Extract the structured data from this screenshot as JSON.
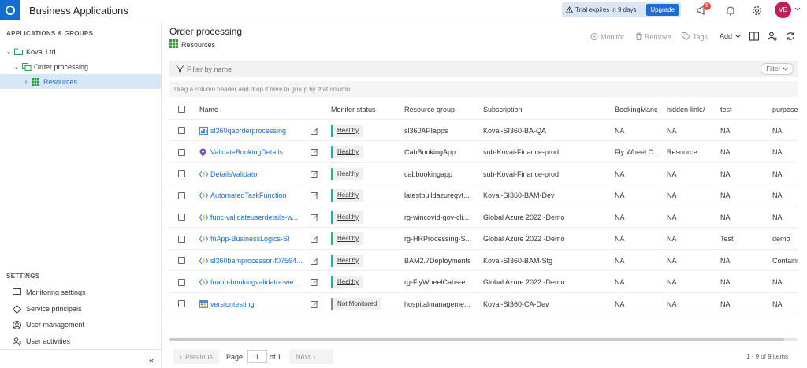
{
  "header": {
    "title": "Business Applications",
    "trial_text": "Trial expires in 9 days",
    "upgrade_label": "Upgrade",
    "notification_count": "5",
    "avatar_initials": "VE"
  },
  "sidebar": {
    "section_title": "APPLICATIONS & GROUPS",
    "tree": {
      "root": "Kovai Ltd",
      "group": "Order processing",
      "selected": "Resources"
    },
    "settings_title": "SETTINGS",
    "settings_items": [
      {
        "label": "Monitoring settings",
        "icon": "monitor-icon"
      },
      {
        "label": "Service principals",
        "icon": "key-icon"
      },
      {
        "label": "User management",
        "icon": "user-icon"
      },
      {
        "label": "User activities",
        "icon": "user-activity-icon"
      }
    ]
  },
  "main": {
    "title": "Order processing",
    "breadcrumb": "Resources",
    "toolbar": {
      "monitor": "Monitor",
      "remove": "Remove",
      "tags": "Tags",
      "add": "Add"
    },
    "filter_placeholder": "Filter by name",
    "filter_button": "Filter",
    "group_hint": "Drag a column header and drop it here to group by that column",
    "columns": [
      "Name",
      "Monitor status",
      "Resource group",
      "Subscription",
      "BookingManc",
      "hidden-link:/",
      "test",
      "purpose"
    ],
    "rows": [
      {
        "name": "sl360qaorderprocessing",
        "icon": "app-service-plan-icon",
        "status": "Healthy",
        "rg": "sl360APIapps",
        "sub": "Kovai-SI360-BA-QA",
        "booking": "NA",
        "hidden": "NA",
        "test": "NA",
        "purpose": "NA"
      },
      {
        "name": "ValidateBookingDetails",
        "icon": "logic-app-icon",
        "status": "Healthy",
        "rg": "CabBookingApp",
        "sub": "sub-Kovai-Finance-prod",
        "booking": "Fly Wheel C...",
        "hidden": "Resource",
        "test": "NA",
        "purpose": "NA"
      },
      {
        "name": "DetailsValidator",
        "icon": "function-app-icon",
        "status": "Healthy",
        "rg": "cabbookingapp",
        "sub": "sub-Kovai-Finance-prod",
        "booking": "NA",
        "hidden": "NA",
        "test": "NA",
        "purpose": "NA"
      },
      {
        "name": "AutomatedTaskFunction",
        "icon": "function-app-icon",
        "status": "Healthy",
        "rg": "latestbuildazuregvt...",
        "sub": "Kovai-SI360-BAM-Dev",
        "booking": "NA",
        "hidden": "NA",
        "test": "NA",
        "purpose": "NA"
      },
      {
        "name": "func-validateuserdetails-w...",
        "icon": "function-app-icon",
        "status": "Healthy",
        "rg": "rg-wincovid-gov-cli...",
        "sub": "Global Azure 2022 -Demo",
        "booking": "NA",
        "hidden": "NA",
        "test": "NA",
        "purpose": "NA"
      },
      {
        "name": "fnApp-BusinessLogics-SI",
        "icon": "function-app-icon",
        "status": "Healthy",
        "rg": "rg-HRProcessing-S...",
        "sub": "Global Azure 2022 -Demo",
        "booking": "NA",
        "hidden": "NA",
        "test": "Test",
        "purpose": "demo"
      },
      {
        "name": "sl360bamprocessor-f07564...",
        "icon": "function-app-icon",
        "status": "Healthy",
        "rg": "BAM2.7Deployments",
        "sub": "Kovai-SI360-BAM-Stg",
        "booking": "NA",
        "hidden": "NA",
        "test": "NA",
        "purpose": "Contains"
      },
      {
        "name": "fnapp-bookingvalidator-we...",
        "icon": "function-app-icon",
        "status": "Healthy",
        "rg": "rg-FlyWheelCabs-e...",
        "sub": "Global Azure 2022 -Demo",
        "booking": "NA",
        "hidden": "NA",
        "test": "NA",
        "purpose": "NA"
      },
      {
        "name": "versiontesting",
        "icon": "storage-account-icon",
        "status": "Not Monitored",
        "rg": "hospitalmanageme...",
        "sub": "Kovai-SI360-CA-Dev",
        "booking": "NA",
        "hidden": "NA",
        "test": "NA",
        "purpose": "NA"
      }
    ],
    "pager": {
      "previous": "Previous",
      "page_label": "Page",
      "page_value": "1",
      "of_label": "of 1",
      "next": "Next",
      "summary": "1 - 9 of 9 items"
    }
  },
  "colors": {
    "brand": "#1170cf",
    "link": "#1a6fd1",
    "healthy": "#1fb09e",
    "avatar": "#c21e5a",
    "badge": "#e8493d"
  }
}
